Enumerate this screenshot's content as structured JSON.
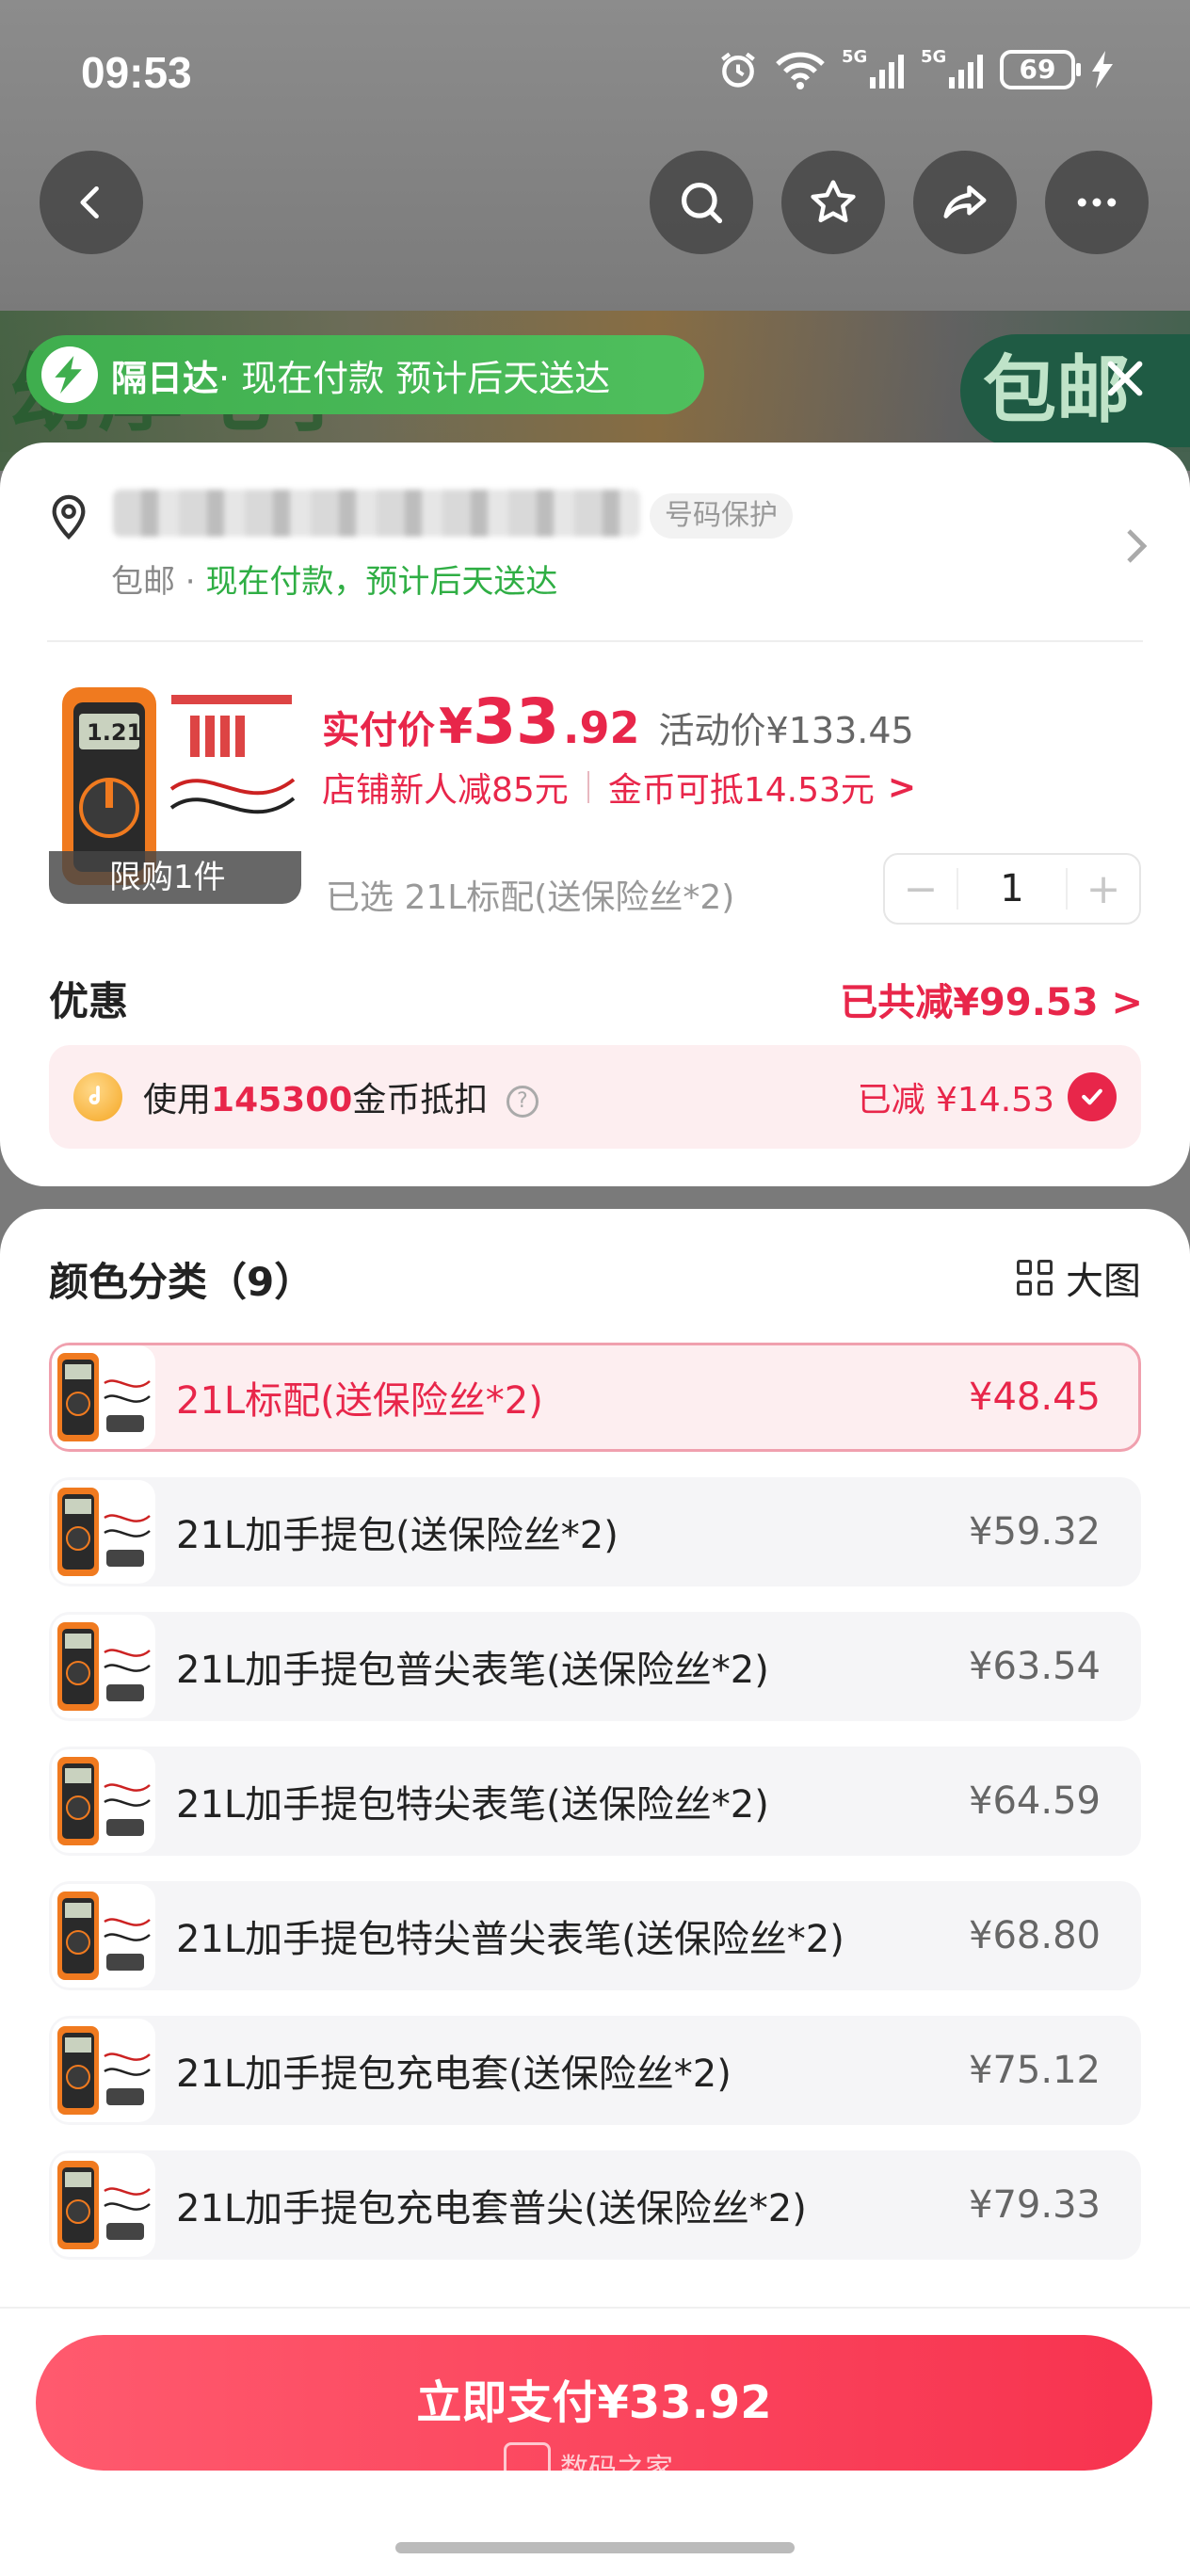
{
  "status": {
    "time": "09:53",
    "battery": "69",
    "net1": "5G",
    "net2": "5G"
  },
  "delivery_pill": {
    "bold": "隔日达",
    "text": " · 现在付款 预计后天送达"
  },
  "backdrop": {
    "banner_word": "幼厚电子",
    "baoyou": "包邮"
  },
  "address": {
    "protect": "号码保护",
    "sub_prefix": "包邮 · ",
    "sub_green": "现在付款，预计后天送达"
  },
  "product": {
    "limit": "限购1件",
    "pay_label": "实付价",
    "currency": "¥",
    "pay_int": "33",
    "pay_dec": ".92",
    "activity_price": "活动价¥133.45",
    "promo1": "店铺新人减85元",
    "promo2": "金币可抵14.53元",
    "promo_arrow": ">",
    "selected": "已选 21L标配(送保险丝*2)",
    "quantity": "1",
    "minus": "−",
    "plus": "+"
  },
  "discount": {
    "title": "优惠",
    "total": "已共减¥99.53 >",
    "coin_prefix": "使用",
    "coin_amount": "145300",
    "coin_suffix": "金币抵扣",
    "coin_saved": "已减 ¥14.53"
  },
  "category": {
    "title": "颜色分类（9）",
    "big_pic": "大图"
  },
  "variants": [
    {
      "name": "21L标配(送保险丝*2)",
      "price": "¥48.45"
    },
    {
      "name": "21L加手提包(送保险丝*2)",
      "price": "¥59.32"
    },
    {
      "name": "21L加手提包普尖表笔(送保险丝*2)",
      "price": "¥63.54"
    },
    {
      "name": "21L加手提包特尖表笔(送保险丝*2)",
      "price": "¥64.59"
    },
    {
      "name": "21L加手提包特尖普尖表笔(送保险丝*2)",
      "price": "¥68.80"
    },
    {
      "name": "21L加手提包充电套(送保险丝*2)",
      "price": "¥75.12"
    },
    {
      "name": "21L加手提包充电套普尖(送保险丝*2)",
      "price": "¥79.33"
    }
  ],
  "pay_button": "立即支付¥33.92",
  "watermark": "数码之家",
  "icons": [
    "back-icon",
    "search-icon",
    "star-icon",
    "share-icon",
    "more-icon",
    "close-icon",
    "location-icon",
    "coin-icon",
    "check-icon",
    "grid-icon"
  ],
  "colors": {
    "accent": "#e8264a",
    "green": "#3fae4e",
    "pink_bg": "#fdeef0"
  }
}
